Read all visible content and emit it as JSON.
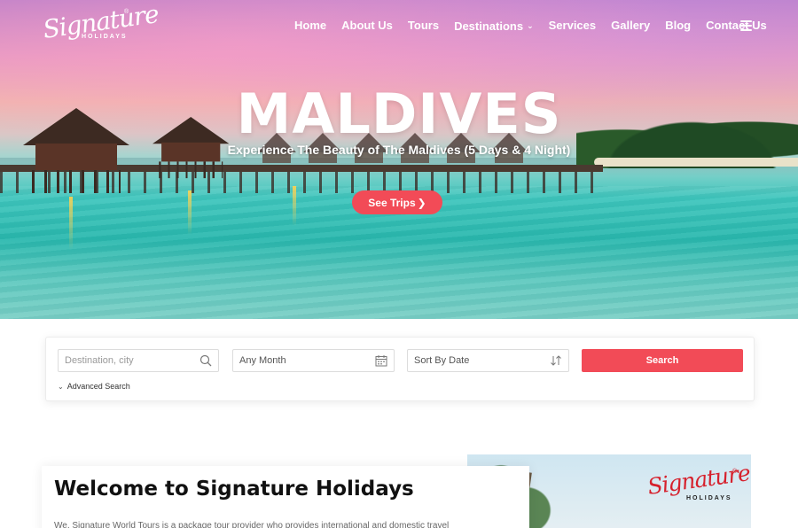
{
  "brand": {
    "logo_script": "Signature",
    "logo_sub": "HOLIDAYS",
    "registered": "®"
  },
  "nav": {
    "items": [
      {
        "label": "Home"
      },
      {
        "label": "About Us"
      },
      {
        "label": "Tours"
      },
      {
        "label": "Destinations",
        "has_dropdown": true
      },
      {
        "label": "Services"
      },
      {
        "label": "Gallery"
      },
      {
        "label": "Blog"
      },
      {
        "label": "Contact Us"
      }
    ],
    "menu_icon": "hamburger-icon"
  },
  "hero": {
    "title": "MALDIVES",
    "subtitle": "Experience The Beauty of The Maldives (5 Days & 4 Night)",
    "cta_label": "See Trips",
    "cta_arrow": "❯"
  },
  "search": {
    "destination_placeholder": "Destination, city",
    "destination_icon": "search-icon",
    "month_value": "Any Month",
    "month_icon": "calendar-icon",
    "sort_value": "Sort By Date",
    "sort_icon": "sort-arrows-icon",
    "button_label": "Search",
    "advanced_label": "Advanced Search"
  },
  "welcome": {
    "title": "Welcome to Signature Holidays",
    "text": "We, Signature World Tours is a package tour provider who provides international and domestic travel"
  },
  "colors": {
    "accent": "#f24b57",
    "white": "#ffffff",
    "heading": "#111111"
  }
}
